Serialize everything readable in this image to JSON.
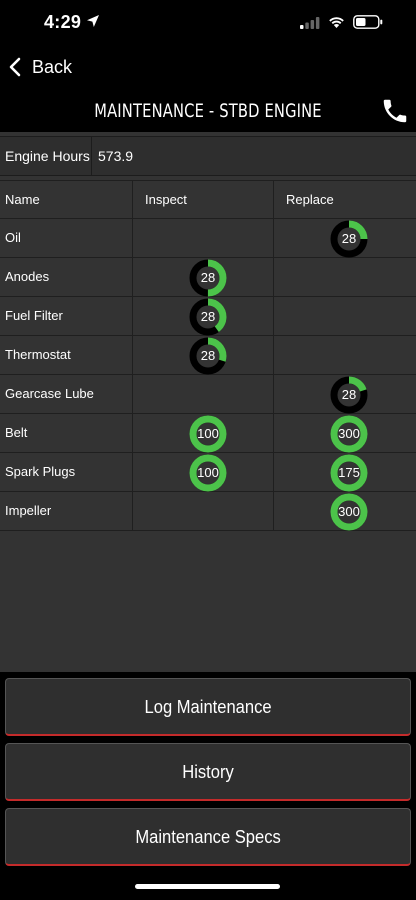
{
  "status_bar": {
    "time": "4:29"
  },
  "nav": {
    "back_label": "Back"
  },
  "header": {
    "title": "MAINTENANCE - STBD ENGINE"
  },
  "engine_hours": {
    "label": "Engine Hours",
    "value": "573.9"
  },
  "table": {
    "columns": [
      "Name",
      "Inspect",
      "Replace"
    ],
    "rows": [
      {
        "name": "Oil",
        "inspect": null,
        "replace": {
          "value": "28",
          "fill": 0.25
        }
      },
      {
        "name": "Anodes",
        "inspect": {
          "value": "28",
          "fill": 0.5
        },
        "replace": null
      },
      {
        "name": "Fuel Filter",
        "inspect": {
          "value": "28",
          "fill": 0.4
        },
        "replace": null
      },
      {
        "name": "Thermostat",
        "inspect": {
          "value": "28",
          "fill": 0.3
        },
        "replace": null
      },
      {
        "name": "Gearcase Lube",
        "inspect": null,
        "replace": {
          "value": "28",
          "fill": 0.2
        }
      },
      {
        "name": "Belt",
        "inspect": {
          "value": "100",
          "fill": 1.0
        },
        "replace": {
          "value": "300",
          "fill": 1.0
        }
      },
      {
        "name": "Spark Plugs",
        "inspect": {
          "value": "100",
          "fill": 1.0
        },
        "replace": {
          "value": "175",
          "fill": 1.0
        }
      },
      {
        "name": "Impeller",
        "inspect": null,
        "replace": {
          "value": "300",
          "fill": 1.0
        }
      }
    ]
  },
  "actions": {
    "log_maintenance": "Log Maintenance",
    "history": "History",
    "maintenance_specs": "Maintenance Specs"
  },
  "colors": {
    "gauge_green": "#4cc34a",
    "gauge_track": "#000000",
    "accent_red": "#c42b2b"
  }
}
